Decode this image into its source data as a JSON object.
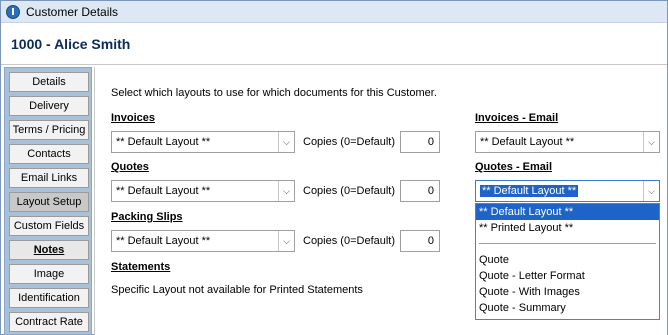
{
  "window": {
    "title": "Customer Details"
  },
  "header": {
    "customer_name": "1000 - Alice Smith"
  },
  "sidebar": {
    "items": [
      {
        "label": "Details"
      },
      {
        "label": "Delivery"
      },
      {
        "label": "Terms / Pricing"
      },
      {
        "label": "Contacts"
      },
      {
        "label": "Email Links"
      },
      {
        "label": "Layout Setup"
      },
      {
        "label": "Custom Fields"
      },
      {
        "label": "Notes"
      },
      {
        "label": "Image"
      },
      {
        "label": "Identification"
      },
      {
        "label": "Contract Rate"
      }
    ]
  },
  "main": {
    "intro": "Select which layouts to use for which documents for this Customer.",
    "invoices": {
      "label": "Invoices",
      "layout": "** Default Layout **",
      "copies_label": "Copies (0=Default)",
      "copies": "0"
    },
    "quotes": {
      "label": "Quotes",
      "layout": "** Default Layout **",
      "copies_label": "Copies (0=Default)",
      "copies": "0"
    },
    "packing_slips": {
      "label": "Packing Slips",
      "layout": "** Default Layout **",
      "copies_label": "Copies (0=Default)",
      "copies": "0"
    },
    "statements": {
      "label": "Statements",
      "note": "Specific Layout not available for Printed Statements"
    },
    "invoices_email": {
      "label": "Invoices - Email",
      "layout": "** Default Layout **"
    },
    "quotes_email": {
      "label": "Quotes - Email",
      "layout": "** Default Layout **",
      "options_top": [
        "** Default Layout **",
        "** Printed Layout **"
      ],
      "options_bottom": [
        "Quote",
        "Quote - Letter Format",
        "Quote - With Images",
        "Quote - Summary"
      ]
    }
  }
}
